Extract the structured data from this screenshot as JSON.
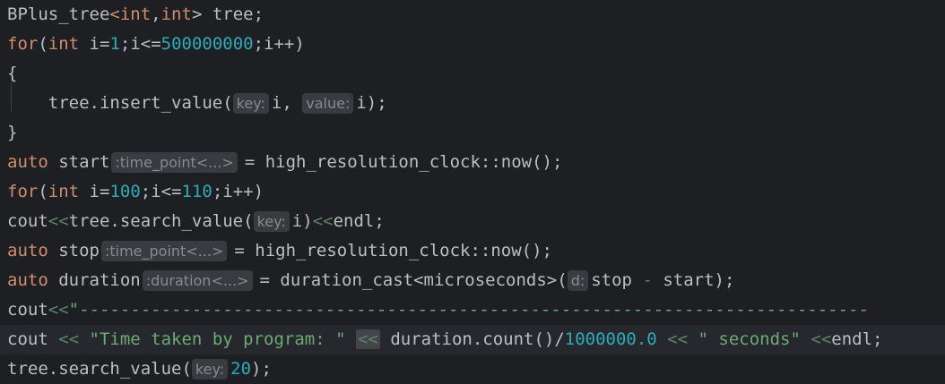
{
  "editor": {
    "language": "C++",
    "current_line_index": 11,
    "colors": {
      "background": "#1e1f22",
      "current_line": "#26282e",
      "keyword": "#cf8e6d",
      "number": "#2aacb8",
      "string": "#6aab73",
      "stream_operator": "#5f826b",
      "inlay_hint_bg": "#393b40",
      "inlay_hint_fg": "#868a91",
      "default": "#bcbec4"
    },
    "lines": [
      {
        "segments": [
          [
            "",
            "BPlus_tree"
          ],
          [
            "kw",
            "<int"
          ],
          [
            "",
            ","
          ],
          [
            "kw",
            "int"
          ],
          [
            "",
            "> tree;"
          ]
        ]
      },
      {
        "segments": [
          [
            "kw",
            "for"
          ],
          [
            "",
            "("
          ],
          [
            "kw",
            "int"
          ],
          [
            "",
            " i="
          ],
          [
            "num",
            "1"
          ],
          [
            "",
            ";i<="
          ],
          [
            "num",
            "500000000"
          ],
          [
            "",
            ";i++)"
          ]
        ]
      },
      {
        "segments": [
          [
            "",
            "{"
          ]
        ]
      },
      {
        "segments": [
          [
            "",
            "    tree.insert_value("
          ],
          [
            "hint",
            "key:"
          ],
          [
            "",
            "i, "
          ],
          [
            "hint",
            "value:"
          ],
          [
            "",
            "i);"
          ]
        ]
      },
      {
        "segments": [
          [
            "",
            "}"
          ]
        ]
      },
      {
        "segments": [
          [
            "kw",
            "auto"
          ],
          [
            "",
            " start"
          ],
          [
            "hint-type",
            ":time_point<...>"
          ],
          [
            "",
            "= high_resolution_clock::now();"
          ]
        ]
      },
      {
        "segments": [
          [
            "kw",
            "for"
          ],
          [
            "",
            "("
          ],
          [
            "kw",
            "int"
          ],
          [
            "",
            " i="
          ],
          [
            "num",
            "100"
          ],
          [
            "",
            ";i<="
          ],
          [
            "num",
            "110"
          ],
          [
            "",
            ";i++)"
          ]
        ]
      },
      {
        "segments": [
          [
            "",
            "cout"
          ],
          [
            "op",
            "<<"
          ],
          [
            "",
            "tree.search_value("
          ],
          [
            "hint",
            "key:"
          ],
          [
            "",
            "i)"
          ],
          [
            "op",
            "<<"
          ],
          [
            "",
            "endl;"
          ]
        ]
      },
      {
        "segments": [
          [
            "kw",
            "auto"
          ],
          [
            "",
            " stop"
          ],
          [
            "hint-type",
            ":time_point<...>"
          ],
          [
            "",
            "= high_resolution_clock::now();"
          ]
        ]
      },
      {
        "segments": [
          [
            "kw",
            "auto"
          ],
          [
            "",
            " duration"
          ],
          [
            "hint-type",
            ":duration<...>"
          ],
          [
            "",
            "= duration_cast<microseconds>("
          ],
          [
            "hint",
            "d:"
          ],
          [
            "",
            "stop "
          ],
          [
            "op",
            "-"
          ],
          [
            "",
            " start);"
          ]
        ]
      },
      {
        "segments": [
          [
            "",
            "cout"
          ],
          [
            "op",
            "<<"
          ],
          [
            "str",
            "\"-----------------------------------------------------------------------------"
          ]
        ]
      },
      {
        "segments": [
          [
            "",
            "cout "
          ],
          [
            "op",
            "<<"
          ],
          [
            "",
            " "
          ],
          [
            "str",
            "\"Time taken by program: \""
          ],
          [
            "",
            " "
          ],
          [
            "op-hl",
            "<<"
          ],
          [
            "",
            " duration.count()/"
          ],
          [
            "num",
            "1000000.0"
          ],
          [
            "",
            " "
          ],
          [
            "op",
            "<<"
          ],
          [
            "",
            " "
          ],
          [
            "str",
            "\" seconds\""
          ],
          [
            "",
            " "
          ],
          [
            "op",
            "<<"
          ],
          [
            "",
            "endl;"
          ]
        ]
      },
      {
        "segments": [
          [
            "",
            "tree.search_value("
          ],
          [
            "hint",
            "key:"
          ],
          [
            "num",
            "20"
          ],
          [
            "",
            ");"
          ]
        ]
      }
    ]
  }
}
